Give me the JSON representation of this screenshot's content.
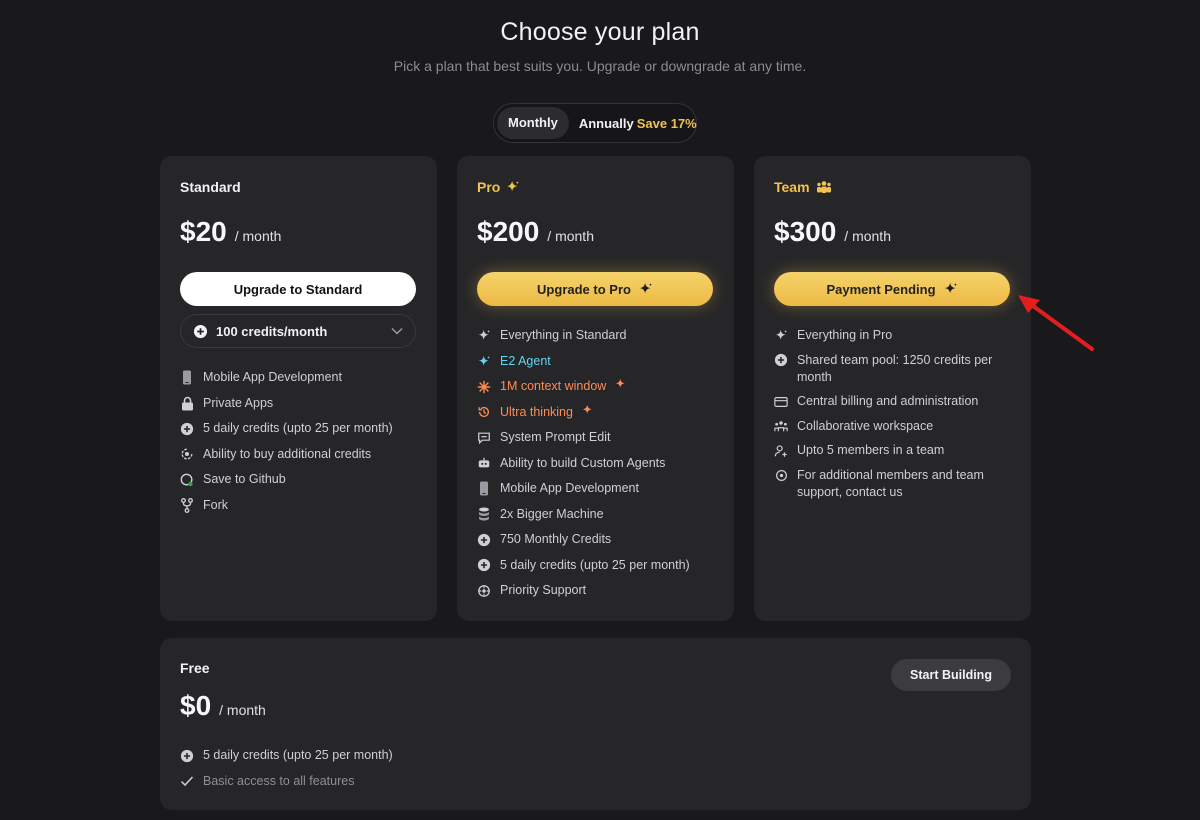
{
  "header": {
    "title": "Choose your plan",
    "subtitle": "Pick a plan that best suits you. Upgrade or downgrade at any time."
  },
  "billing_toggle": {
    "monthly_label": "Monthly",
    "annual_label": "Annually",
    "annual_badge": "Save 17%",
    "selected": "Monthly"
  },
  "plans": {
    "standard": {
      "name": "Standard",
      "price": "$20",
      "period": "/ month",
      "button_label": "Upgrade to Standard",
      "credits_select": "100 credits/month",
      "features": [
        {
          "label": "Mobile App Development",
          "icon": "phone-icon"
        },
        {
          "label": "Private Apps",
          "icon": "lock-icon"
        },
        {
          "label": "5 daily credits (upto 25 per month)",
          "icon": "plus-circle-icon"
        },
        {
          "label": "Ability to buy additional credits",
          "icon": "refresh-coin-icon"
        },
        {
          "label": "Save to Github",
          "icon": "github-icon"
        },
        {
          "label": "Fork",
          "icon": "fork-icon"
        }
      ]
    },
    "pro": {
      "name": "Pro",
      "price": "$200",
      "period": "/ month",
      "button_label": "Upgrade to Pro",
      "features": [
        {
          "label": "Everything in Standard",
          "icon": "sparkle-icon"
        },
        {
          "label": "E2 Agent",
          "icon": "sparkle-icon",
          "color": "#5fd6f2"
        },
        {
          "label": "1M context window",
          "icon": "burst-icon",
          "color": "#ff8a55"
        },
        {
          "label": "Ultra thinking",
          "icon": "history-icon",
          "color": "#ff8a55"
        },
        {
          "label": "System Prompt Edit",
          "icon": "prompt-edit-icon"
        },
        {
          "label": "Ability to build Custom Agents",
          "icon": "robot-icon"
        },
        {
          "label": "Mobile App Development",
          "icon": "phone-icon"
        },
        {
          "label": "2x Bigger Machine",
          "icon": "database-icon"
        },
        {
          "label": "750 Monthly Credits",
          "icon": "plus-circle-icon"
        },
        {
          "label": "5 daily credits (upto 25 per month)",
          "icon": "plus-circle-icon"
        },
        {
          "label": "Priority Support",
          "icon": "support-icon"
        }
      ]
    },
    "team": {
      "name": "Team",
      "price": "$300",
      "period": "/ month",
      "button_label": "Payment Pending",
      "features": [
        {
          "label": "Everything in Pro",
          "icon": "sparkle-icon"
        },
        {
          "label": "Shared team pool: 1250 credits per month",
          "icon": "plus-circle-icon"
        },
        {
          "label": "Central billing and administration",
          "icon": "card-icon"
        },
        {
          "label": "Collaborative workspace",
          "icon": "people-icon"
        },
        {
          "label": "Upto 5 members in a team",
          "icon": "user-add-icon"
        },
        {
          "label": "For additional members and team support, contact us",
          "icon": "support-icon"
        }
      ]
    },
    "free": {
      "name": "Free",
      "price": "$0",
      "period": "/ month",
      "button_label": "Start Building",
      "features": [
        {
          "label": "5 daily credits (upto 25 per month)",
          "icon": "plus-circle-icon"
        },
        {
          "label": "Basic access to all features",
          "icon": "check-icon"
        }
      ]
    }
  },
  "colors": {
    "background": "#19191b",
    "card": "#262628",
    "gold": "#f2c24f",
    "annotation_arrow": "#e41e1e"
  }
}
